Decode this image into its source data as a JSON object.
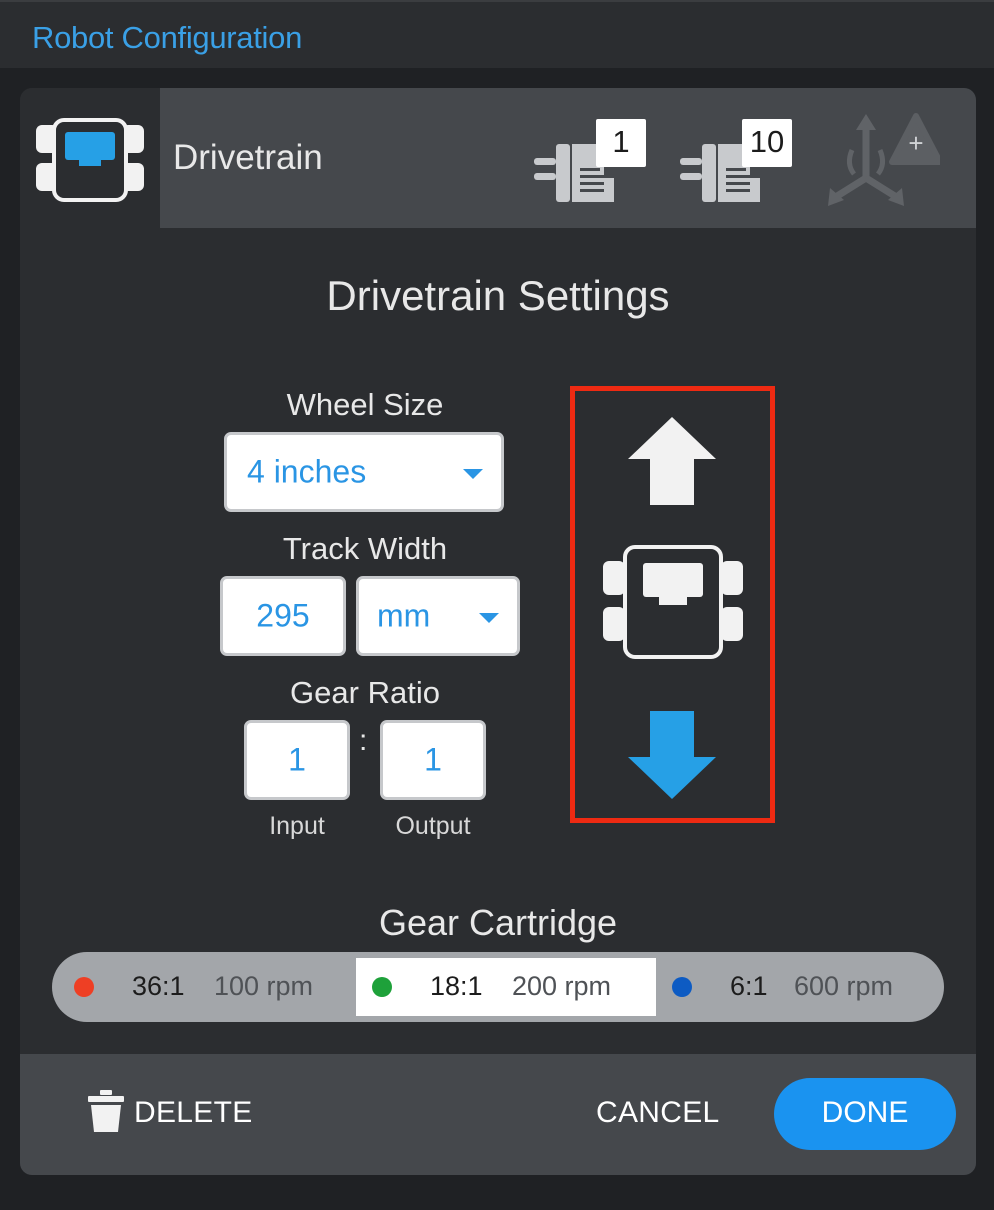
{
  "window": {
    "title": "Robot Configuration"
  },
  "device": {
    "name": "Drivetrain"
  },
  "ports": [
    {
      "label": "1",
      "icon": "motor-port-icon"
    },
    {
      "label": "10",
      "icon": "motor-port-icon"
    },
    {
      "label": "+",
      "icon": "gyro-add-icon"
    }
  ],
  "settings": {
    "title": "Drivetrain Settings",
    "wheel_size": {
      "label": "Wheel Size",
      "value": "4 inches"
    },
    "track_width": {
      "label": "Track Width",
      "value": "295",
      "unit": "mm"
    },
    "gear_ratio": {
      "label": "Gear Ratio",
      "separator": ":",
      "input": "1",
      "input_label": "Input",
      "output": "1",
      "output_label": "Output"
    }
  },
  "direction": {
    "selected": "reverse",
    "colors": {
      "inactive": "#f2f2f2",
      "active": "#26a0e6",
      "highlight": "#ee2a12"
    }
  },
  "gear_cartridge": {
    "title": "Gear Cartridge",
    "options": [
      {
        "ratio": "36:1",
        "rpm": "100 rpm",
        "color": "#ee3f24",
        "selected": false
      },
      {
        "ratio": "18:1",
        "rpm": "200 rpm",
        "color": "#1ea13a",
        "selected": true
      },
      {
        "ratio": "6:1",
        "rpm": "600 rpm",
        "color": "#0d5bc3",
        "selected": false
      }
    ]
  },
  "footer": {
    "delete_label": "DELETE",
    "cancel_label": "CANCEL",
    "done_label": "DONE"
  }
}
